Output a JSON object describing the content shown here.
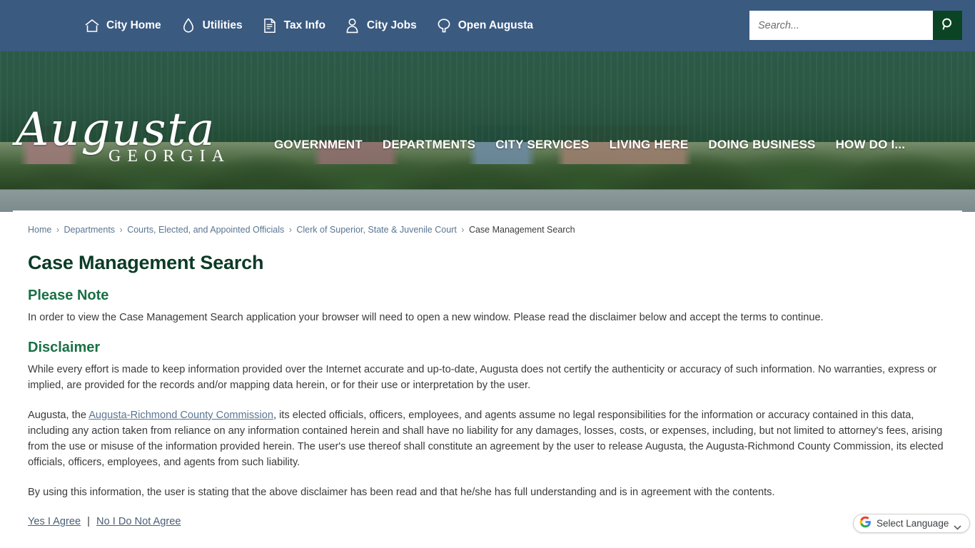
{
  "topbar": {
    "links": [
      {
        "label": "City Home",
        "icon": "home-icon"
      },
      {
        "label": "Utilities",
        "icon": "water-drop-icon"
      },
      {
        "label": "Tax Info",
        "icon": "document-icon"
      },
      {
        "label": "City Jobs",
        "icon": "person-icon"
      },
      {
        "label": "Open Augusta",
        "icon": "tree-icon"
      }
    ],
    "background_color": "#3b5a80"
  },
  "search": {
    "placeholder": "Search...",
    "value": "",
    "button_icon": "search-icon",
    "button_color": "#0b4424"
  },
  "header": {
    "logo_script": "Augusta",
    "logo_sub": "GEORGIA",
    "nav": [
      {
        "label": "GOVERNMENT"
      },
      {
        "label": "DEPARTMENTS"
      },
      {
        "label": "CITY SERVICES"
      },
      {
        "label": "LIVING HERE"
      },
      {
        "label": "DOING BUSINESS"
      },
      {
        "label": "HOW DO I..."
      }
    ],
    "band_color": "#184a34"
  },
  "breadcrumb": {
    "items": [
      "Home",
      "Departments",
      "Courts, Elected, and Appointed Officials",
      "Clerk of Superior, State & Juvenile Court"
    ],
    "separator": "›",
    "current": "Case Management Search"
  },
  "page": {
    "title": "Case Management Search",
    "title_color": "#0b3b28",
    "sections": {
      "note_heading": "Please Note",
      "note_body": "In order to view the Case Management Search application your browser will need to open a new window. Please read the disclaimer below and accept the terms to continue.",
      "disclaimer_heading": "Disclaimer",
      "disclaimer_p1": "While every effort is made to keep information provided over the Internet accurate and up-to-date, Augusta does not certify the authenticity or accuracy of such information. No warranties, express or implied, are provided for the records and/or mapping data herein, or for their use or interpretation by the user.",
      "disclaimer_p2_before": "Augusta, the ",
      "disclaimer_p2_link": "Augusta-Richmond County Commission",
      "disclaimer_p2_after": ", its elected officials, officers, employees, and agents assume no legal responsibilities for the information or accuracy contained in this data, including any action taken from reliance on any information contained herein and shall have no liability for any damages, losses, costs, or expenses, including, but not limited to attorney's fees, arising from the use or misuse of the information provided herein. The user's use thereof shall constitute an agreement by the user to release Augusta, the Augusta-Richmond County Commission, its elected officials, officers, employees, and agents from such liability.",
      "disclaimer_p3": "By using this information, the user is stating that the above disclaimer has been read and that he/she has full understanding and is in agreement with the contents.",
      "heading_color": "#1a7046"
    },
    "actions": {
      "agree_label": "Yes I Agree",
      "separator": "|",
      "disagree_label": "No I Do Not Agree"
    }
  },
  "translate_widget": {
    "label": "Select Language",
    "icon": "google-g-icon",
    "chevron": "chevron-down-icon"
  }
}
